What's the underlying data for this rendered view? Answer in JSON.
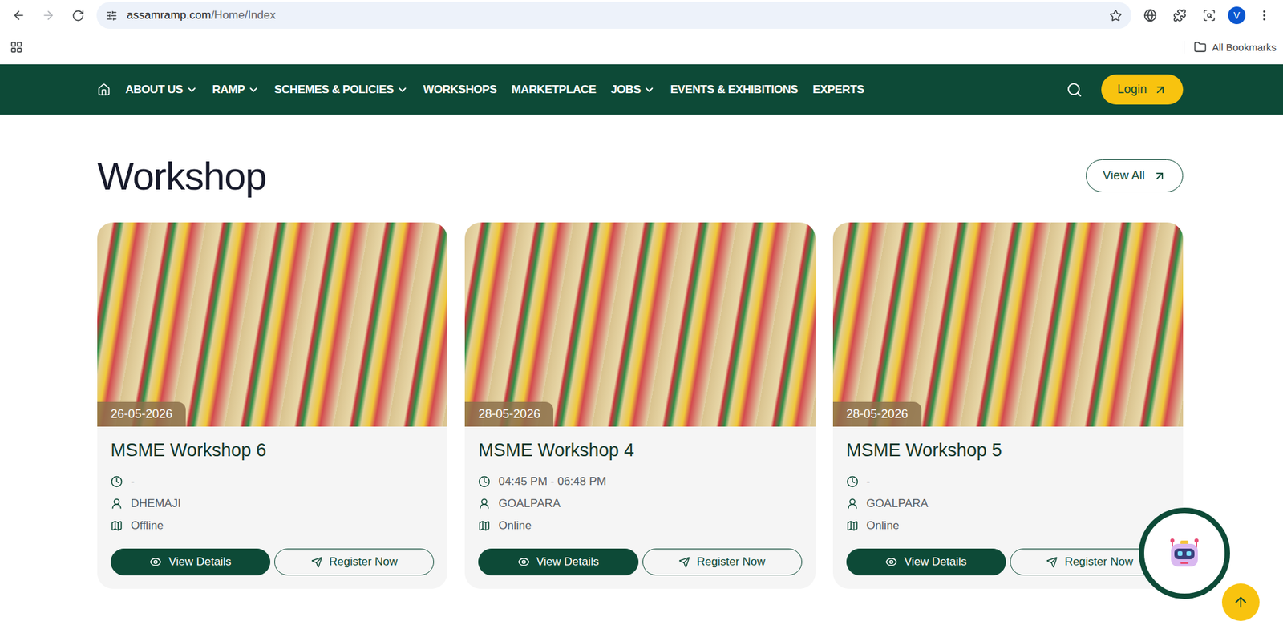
{
  "browser": {
    "url_host": "assamramp.com",
    "url_path": "/Home/Index",
    "avatar": "V",
    "bookmarks_label": "All Bookmarks",
    "forward_disabled": true
  },
  "nav": {
    "items": [
      {
        "label": "ABOUT US",
        "dropdown": true
      },
      {
        "label": "RAMP",
        "dropdown": true
      },
      {
        "label": "SCHEMES & POLICIES",
        "dropdown": true
      },
      {
        "label": "WORKSHOPS",
        "dropdown": false
      },
      {
        "label": "MARKETPLACE",
        "dropdown": false
      },
      {
        "label": "JOBS",
        "dropdown": true
      },
      {
        "label": "EVENTS & EXHIBITIONS",
        "dropdown": false
      },
      {
        "label": "EXPERTS",
        "dropdown": false
      }
    ],
    "login": "Login"
  },
  "section": {
    "title": "Workshop",
    "view_all": "View All"
  },
  "cards": [
    {
      "date": "26-05-2026",
      "title": "MSME Workshop 6",
      "time": "-",
      "location": "DHEMAJI",
      "mode": "Offline",
      "view": "View Details",
      "register": "Register Now"
    },
    {
      "date": "28-05-2026",
      "title": "MSME Workshop 4",
      "time": "04:45 PM - 06:48 PM",
      "location": "GOALPARA",
      "mode": "Online",
      "view": "View Details",
      "register": "Register Now"
    },
    {
      "date": "28-05-2026",
      "title": "MSME Workshop 5",
      "time": "-",
      "location": "GOALPARA",
      "mode": "Online",
      "view": "View Details",
      "register": "Register Now"
    }
  ]
}
